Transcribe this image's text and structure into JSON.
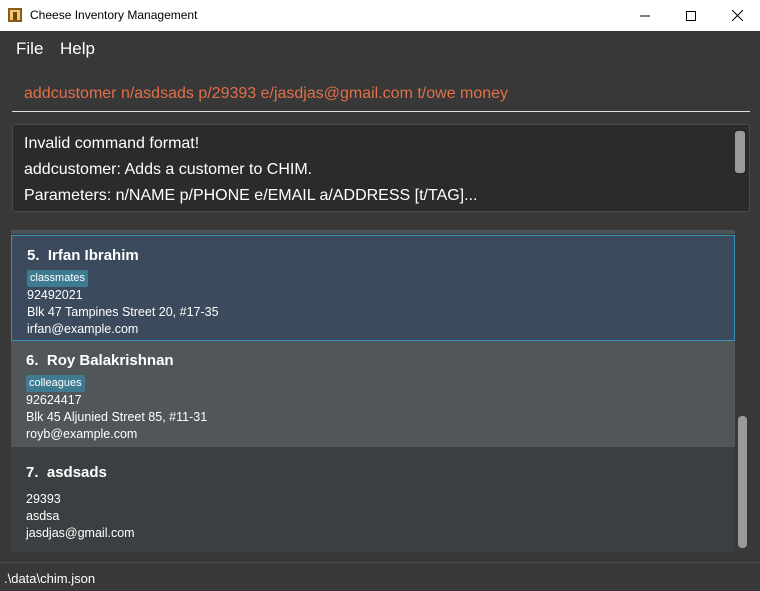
{
  "window": {
    "title": "Cheese Inventory Management",
    "controls": {
      "minimize": "—",
      "maximize": "☐",
      "close": "✕"
    }
  },
  "menu": {
    "file_label": "File",
    "help_label": "Help"
  },
  "command": {
    "value": "addcustomer n/asdsads p/29393 e/jasdjas@gmail.com t/owe money",
    "text_color": "#e0704a"
  },
  "result": {
    "lines": [
      "Invalid command format!",
      "addcustomer: Adds a customer to CHIM.",
      "Parameters: n/NAME p/PHONE e/EMAIL a/ADDRESS [t/TAG]..."
    ]
  },
  "customers": [
    {
      "index": "5.",
      "name": "Irfan Ibrahim",
      "tag": "classmates",
      "phone": "92492021",
      "address": "Blk 47 Tampines Street 20, #17-35",
      "email": "irfan@example.com",
      "selected": true
    },
    {
      "index": "6.",
      "name": "Roy Balakrishnan",
      "tag": "colleagues",
      "phone": "92624417",
      "address": "Blk 45 Aljunied Street 85, #11-31",
      "email": "royb@example.com",
      "selected": false
    },
    {
      "index": "7.",
      "name": "asdsads",
      "phone": "29393",
      "address": "asdsa",
      "email": "jasdjas@gmail.com",
      "selected": false
    }
  ],
  "status": {
    "file_path": ".\\data\\chim.json"
  },
  "colors": {
    "background": "#383838",
    "selected_card": "#3b4a5c",
    "selected_border": "#3a8fb7",
    "tag": "#3e7b91"
  }
}
